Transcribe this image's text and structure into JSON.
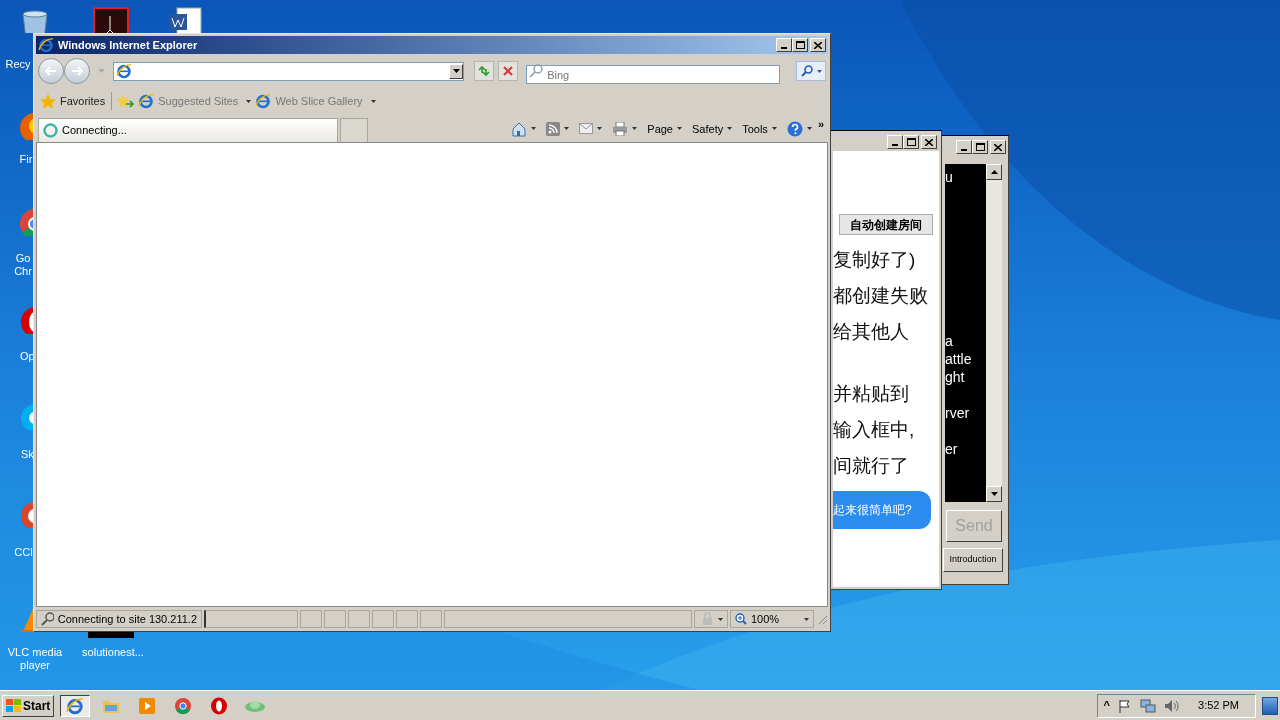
{
  "desktop": {
    "icons": [
      {
        "kind": "recycle-bin",
        "lines": [
          "Recy"
        ]
      },
      {
        "kind": "firefox",
        "lines": [
          "Fir"
        ]
      },
      {
        "kind": "chrome",
        "lines": [
          "Go",
          "Chr"
        ]
      },
      {
        "kind": "opera",
        "lines": [
          "Op"
        ]
      },
      {
        "kind": "skype",
        "lines": [
          "Sk"
        ]
      },
      {
        "kind": "ccleaner",
        "lines": [
          "CCl"
        ]
      },
      {
        "kind": "vlc",
        "lines": [
          "VLC media",
          "player"
        ]
      },
      {
        "kind": "pdf"
      },
      {
        "kind": "word"
      },
      {
        "kind": "file",
        "lines": [
          "solutionest..."
        ]
      }
    ]
  },
  "browser": {
    "title": "Windows Internet Explorer",
    "active": true,
    "search": {
      "placeholder": "Bing"
    },
    "favorites": {
      "label": "Favorites",
      "links": [
        {
          "label": "Suggested Sites"
        },
        {
          "label": "Web Slice Gallery"
        }
      ]
    },
    "tab": {
      "label": "Connecting...",
      "loading": true
    },
    "commands": [
      {
        "kind": "home"
      },
      {
        "kind": "feeds"
      },
      {
        "kind": "mail"
      },
      {
        "kind": "print"
      },
      {
        "kind": "menu",
        "label": "Page"
      },
      {
        "kind": "menu",
        "label": "Safety"
      },
      {
        "kind": "menu",
        "label": "Tools"
      },
      {
        "kind": "help"
      }
    ],
    "overflow": "»",
    "status": {
      "text": "Connecting to site 130.211.2",
      "zoom": "100%"
    }
  },
  "chat_window": {
    "active": false,
    "button": "自动创建房间",
    "lines": [
      "复制好了)",
      "都创建失败",
      "给其他人",
      "并粘贴到",
      "输入框中,",
      "间就行了"
    ],
    "bubble": "起来很简单吧?"
  },
  "console_window": {
    "active": false,
    "lines": [
      "u",
      "a",
      "attle",
      "ght",
      "rver",
      "er"
    ],
    "send": {
      "label": "Send",
      "disabled": true
    },
    "intro": {
      "label": "Introduction"
    }
  },
  "taskbar": {
    "start": "Start",
    "apps": [
      {
        "kind": "ie",
        "selected": true
      },
      {
        "kind": "folder",
        "selected": false
      },
      {
        "kind": "media",
        "selected": false
      },
      {
        "kind": "chrome",
        "selected": false
      },
      {
        "kind": "opera",
        "selected": false
      },
      {
        "kind": "green",
        "selected": false
      }
    ],
    "tray": {
      "expand": "^",
      "clock": "3:52 PM"
    }
  }
}
